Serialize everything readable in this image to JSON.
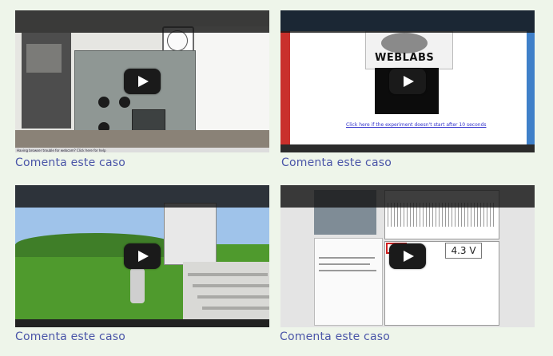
{
  "cards": [
    {
      "caption": "Comenta este caso",
      "thumb_footer_text": "Having browser trouble for webcam? Click here for help"
    },
    {
      "caption": "Comenta este caso",
      "logo_text": "WEBLABS",
      "start_link": "Click here if the experiment doesn't start after 10 seconds"
    },
    {
      "caption": "Comenta este caso"
    },
    {
      "caption": "Comenta este caso",
      "voltage_readout": "4.3 V"
    }
  ],
  "icons": {
    "play": "play-button-icon"
  }
}
